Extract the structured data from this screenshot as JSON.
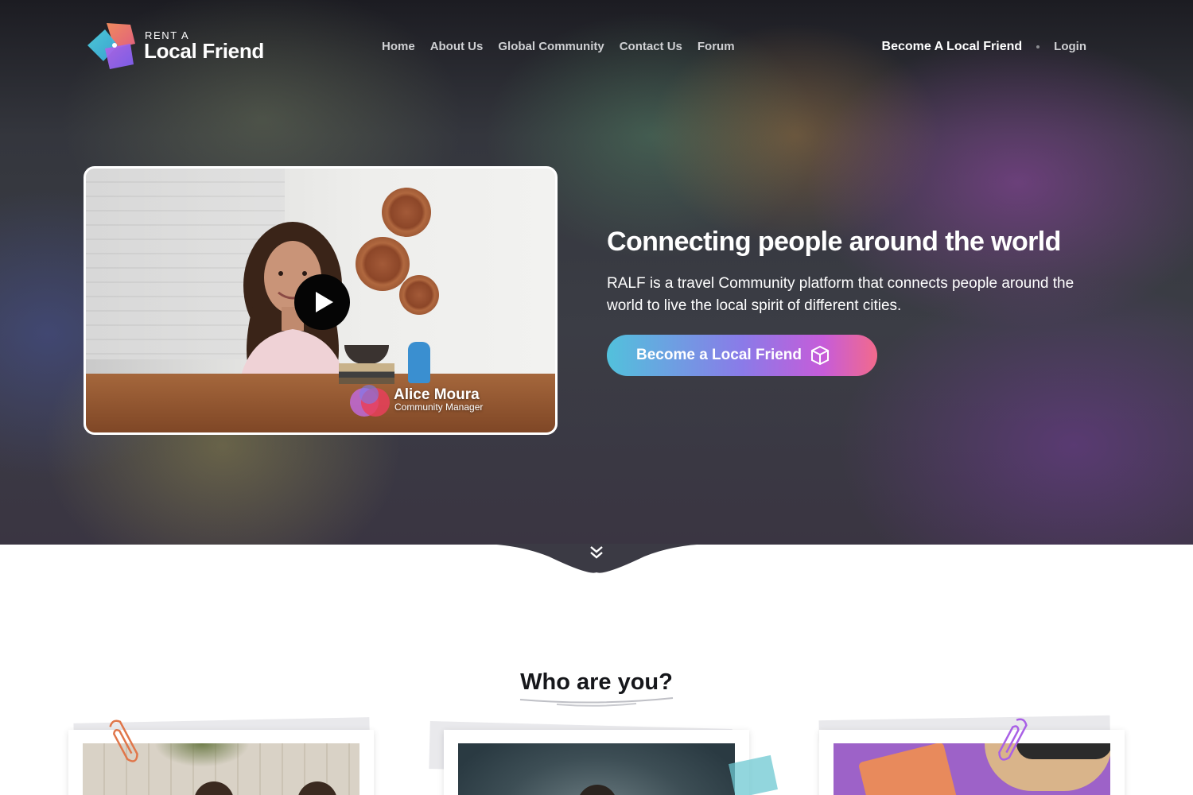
{
  "brand": {
    "small": "RENT A",
    "name": "Local Friend"
  },
  "nav": {
    "items": [
      {
        "label": "Home"
      },
      {
        "label": "About Us"
      },
      {
        "label": "Global Community"
      },
      {
        "label": "Contact Us"
      },
      {
        "label": "Forum"
      }
    ],
    "become_label": "Become A Local Friend",
    "login_label": "Login"
  },
  "hero": {
    "video": {
      "person_name": "Alice Moura",
      "person_role": "Community Manager"
    },
    "title": "Connecting people around the world",
    "description": "RALF is a travel Community platform that connects people around the world to live the local spirit of different cities.",
    "cta_label": "Become a Local Friend"
  },
  "who": {
    "title": "Who are you?"
  },
  "colors": {
    "accent_gradient": [
      "#52c1dc",
      "#8a7be8",
      "#c65cd9",
      "#f26a8c"
    ],
    "hero_bg": "#3b3d45",
    "title_text": "#16171b"
  },
  "icons": [
    "logo-icon",
    "play-icon",
    "ralf-badge-icon",
    "cube-icon",
    "chevrons-down-icon",
    "paperclip-icon"
  ]
}
